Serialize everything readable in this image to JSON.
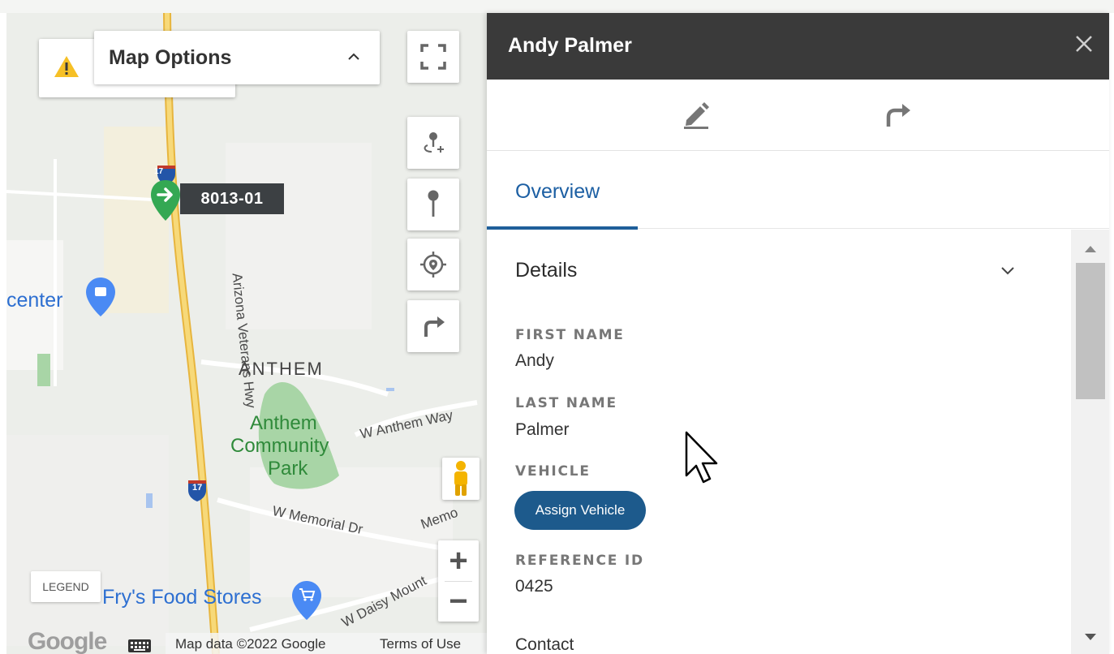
{
  "map": {
    "options_title": "Map Options",
    "vehicle_marker_label": "8013-01",
    "place_labels": {
      "center": "center",
      "anthem": "ANTHEM",
      "park_line1": "Anthem",
      "park_line2": "Community",
      "park_line3": "Park",
      "road_w_anthem_way": "W Anthem Way",
      "road_arizona_veterans_hwy": "Arizona Veterans Hwy",
      "road_w_memorial_dr": "W Memorial Dr",
      "road_memo": "Memo",
      "road_w_daisy_mount": "W Daisy Mount",
      "frys": "Fry's Food Stores",
      "shield_17_top": "17",
      "shield_17_bottom": "17"
    },
    "legend_label": "LEGEND",
    "attribution": {
      "google_logo": "Google",
      "map_data": "Map data ©2022 Google",
      "terms": "Terms of Use"
    },
    "zoom_in_label": "+",
    "zoom_out_label": "−",
    "icons": {
      "warning": "warning-icon",
      "fullscreen": "fullscreen-icon",
      "add_stop": "add-stop-icon",
      "pin": "pin-icon",
      "locate": "locate-icon",
      "route": "route-icon",
      "pegman": "pegman-icon",
      "keyboard": "keyboard-icon"
    },
    "colors": {
      "highway": "#f3c550",
      "park": "#a8d5a6",
      "marker_green": "#34a853",
      "water": "#a8c4ef"
    }
  },
  "panel": {
    "title": "Andy Palmer",
    "tabs": [
      {
        "label": "Overview",
        "active": true
      }
    ],
    "section": {
      "title": "Details",
      "fields": [
        {
          "label": "FIRST NAME",
          "value": "Andy"
        },
        {
          "label": "LAST NAME",
          "value": "Palmer"
        },
        {
          "label": "VEHICLE",
          "button": "Assign Vehicle"
        },
        {
          "label": "REFERENCE ID",
          "value": "0425"
        }
      ],
      "next_section": "Contact"
    },
    "icons": {
      "close": "close-icon",
      "edit": "pencil-icon",
      "share": "share-arrow-icon",
      "chevron": "chevron-down-icon"
    },
    "colors": {
      "header_bg": "#3a3a3a",
      "accent": "#1d5a8c"
    }
  }
}
